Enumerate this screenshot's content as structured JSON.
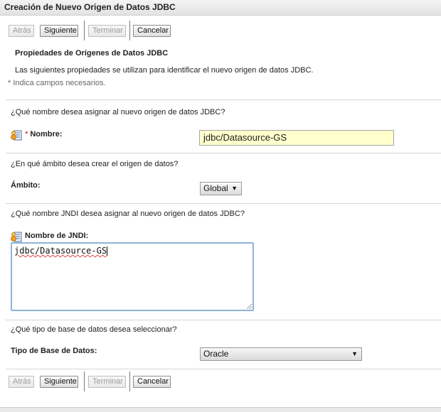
{
  "window": {
    "title": "Creación de Nuevo Origen de Datos JDBC"
  },
  "wizard_buttons": {
    "back": "Atrás",
    "next": "Siguiente",
    "finish": "Terminar",
    "cancel": "Cancelar"
  },
  "section": {
    "heading": "Propiedades de Orígenes de Datos JDBC",
    "description": "Las siguientes propiedades se utilizan para identificar el nuevo origen de datos JDBC.",
    "required_note": "* Indica campos necesarios."
  },
  "name_field": {
    "question": "¿Qué nombre desea asignar al nuevo origen de datos JDBC?",
    "required_mark": "*",
    "label": "Nombre:",
    "value": "jdbc/Datasource-GS"
  },
  "scope_field": {
    "question": "¿En qué ámbito desea crear el origen de datos?",
    "label": "Ámbito:",
    "selected": "Global"
  },
  "jndi_field": {
    "question": "¿Qué nombre JNDI desea asignar al nuevo origen de datos JDBC?",
    "label": "Nombre de JNDI:",
    "value": "jdbc/Datasource-GS"
  },
  "db_type_field": {
    "question": "¿Qué tipo de base de datos desea seleccionar?",
    "label": "Tipo de Base de Datos:",
    "selected": "Oracle"
  },
  "icons": {
    "field_help": "field-help-icon",
    "dropdown": "chevron-down-icon"
  },
  "colors": {
    "required_input_bg": "#ffffcc",
    "focus_border": "#8fb3d9"
  }
}
